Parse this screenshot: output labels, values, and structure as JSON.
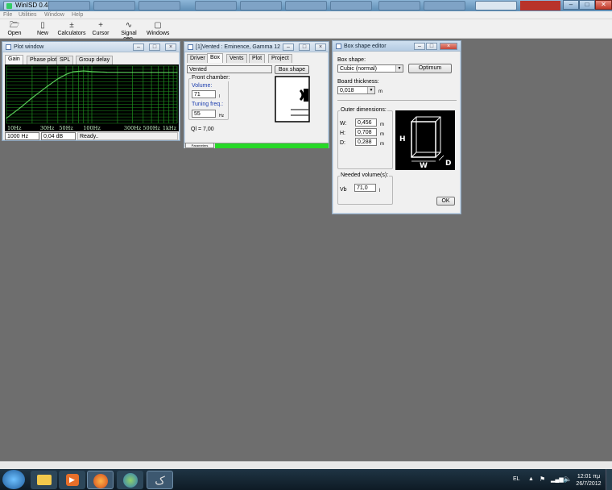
{
  "app": {
    "title": "WinISD 0.44",
    "background_tabs": [
      "",
      "",
      "",
      "",
      "",
      "",
      "",
      "",
      "",
      "",
      ""
    ]
  },
  "menu": [
    "File",
    "Utilities",
    "Window",
    "Help"
  ],
  "toolbar": [
    {
      "label": "Open",
      "icon": "folder-open-icon",
      "glyph": "🗁"
    },
    {
      "label": "New",
      "icon": "new-document-icon",
      "glyph": "▯"
    },
    {
      "label": "Calculators",
      "icon": "calculator-icon",
      "glyph": "±"
    },
    {
      "label": "Cursor",
      "icon": "cursor-icon",
      "glyph": "+"
    },
    {
      "label": "Signal gen.",
      "icon": "signal-generator-icon",
      "glyph": "∿"
    },
    {
      "label": "Windows",
      "icon": "windows-icon",
      "glyph": "▢"
    }
  ],
  "plot_window": {
    "title": "Plot window",
    "tabs": [
      "Gain",
      "Phase plot",
      "SPL",
      "Group delay"
    ],
    "x_ticks": [
      "10Hz",
      "30Hz",
      "50Hz",
      "100Hz",
      "300Hz",
      "500Hz",
      "1kHz"
    ],
    "status": {
      "freq": "1000 Hz",
      "gain": "0,04 dB",
      "state": "Ready.."
    }
  },
  "chart_data": {
    "type": "line",
    "title": "",
    "xlabel": "",
    "ylabel": "",
    "x_scale": "log",
    "xlim": [
      10,
      1000
    ],
    "ylim": [
      -40,
      5
    ],
    "x": [
      10,
      15,
      20,
      30,
      40,
      50,
      60,
      80,
      100,
      150,
      200,
      300,
      500,
      1000
    ],
    "series": [
      {
        "values": [
          -36,
          -27,
          -20,
          -11,
          -5,
          -1.5,
          0.5,
          1.2,
          0.6,
          0.2,
          0.1,
          0.05,
          0.04,
          0.04
        ]
      }
    ],
    "grid": true,
    "colors": {
      "background": "#000000",
      "grid": "#1f8f1f",
      "line": "#58c858"
    }
  },
  "project_window": {
    "title": "[1]Vented : Eminence, Gamma 12",
    "tabs": [
      "Driver",
      "Box",
      "Vents",
      "Plot",
      "Project"
    ],
    "box_type": "Vented",
    "box_shape_button": "Box shape",
    "front_chamber": "Front chamber:",
    "volume_label": "Volume:",
    "volume_value": "71",
    "volume_unit": "l",
    "tuning_label": "Tuning freq.:",
    "tuning_value": "55",
    "tuning_unit": "Hz",
    "ql": "Ql = 7,00",
    "progress_label": "Parameters",
    "progress": 1.0
  },
  "box_editor": {
    "title": "Box shape editor",
    "shape_label": "Box shape:",
    "shape_value": "Cubic (normal)",
    "optimum_button": "Optimum",
    "thickness_label": "Board thickness:",
    "thickness_value": "0,018",
    "thickness_unit": "m",
    "outer_label": "Outer dimensions:",
    "dims": [
      {
        "label": "W:",
        "value": "0,456",
        "unit": "m"
      },
      {
        "label": "H:",
        "value": "0,708",
        "unit": "m"
      },
      {
        "label": "D:",
        "value": "0,288",
        "unit": "m"
      }
    ],
    "diagram_labels": {
      "h": "H",
      "w": "W",
      "d": "D"
    },
    "needed_label": "Needed volume(s):",
    "vb_label": "Vb",
    "vb_value": "71,0",
    "vb_unit": "l",
    "ok_button": "OK"
  },
  "tray": {
    "lang": "EL",
    "time": "12:01 πμ",
    "date": "26/7/2012"
  }
}
